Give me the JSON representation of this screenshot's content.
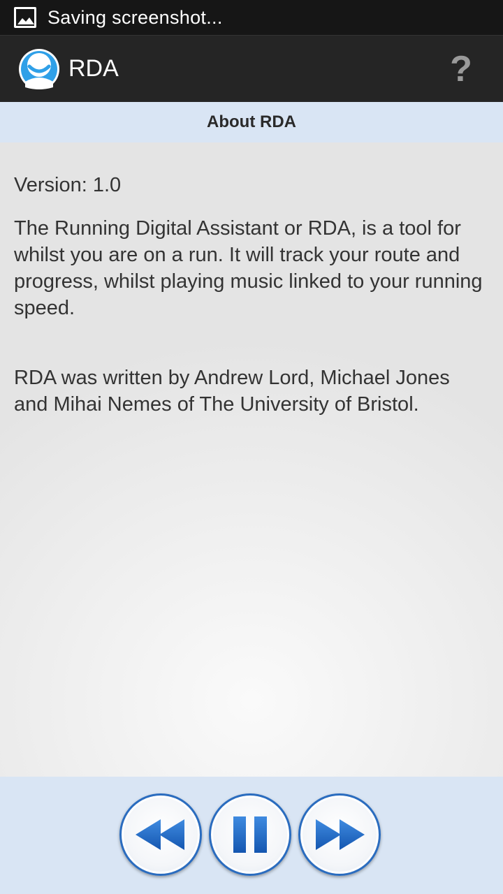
{
  "status_bar": {
    "icon": "image-icon",
    "text": "Saving screenshot..."
  },
  "action_bar": {
    "logo": "rda-logo",
    "title": "RDA",
    "help_label": "?"
  },
  "subheader": {
    "title": "About RDA"
  },
  "content": {
    "version": "Version: 1.0",
    "paragraph1": "The Running Digital Assistant or RDA, is a tool for whilst you are on a run. It will track your route and progress, whilst playing music linked to your running speed.",
    "paragraph2": "RDA was written by Andrew Lord, Michael Jones and Mihai Nemes of The University of Bristol."
  },
  "player_controls": {
    "buttons": [
      {
        "name": "rewind",
        "icon": "rewind-icon"
      },
      {
        "name": "pause",
        "icon": "pause-icon"
      },
      {
        "name": "fast-forward",
        "icon": "fast-forward-icon"
      }
    ]
  },
  "colors": {
    "accent_blue": "#1f6fcf",
    "subheader_bg": "#d9e5f4",
    "action_bar_bg": "#252525"
  }
}
